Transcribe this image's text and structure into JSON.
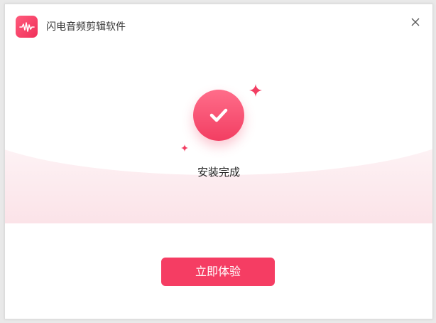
{
  "app": {
    "title": "闪电音频剪辑软件",
    "logo_icon": "audio-waveform-icon",
    "brand_color": "#f53d63"
  },
  "window": {
    "close_icon": "close-icon"
  },
  "status": {
    "icon": "checkmark-icon",
    "message": "安装完成"
  },
  "actions": {
    "primary_label": "立即体验"
  }
}
